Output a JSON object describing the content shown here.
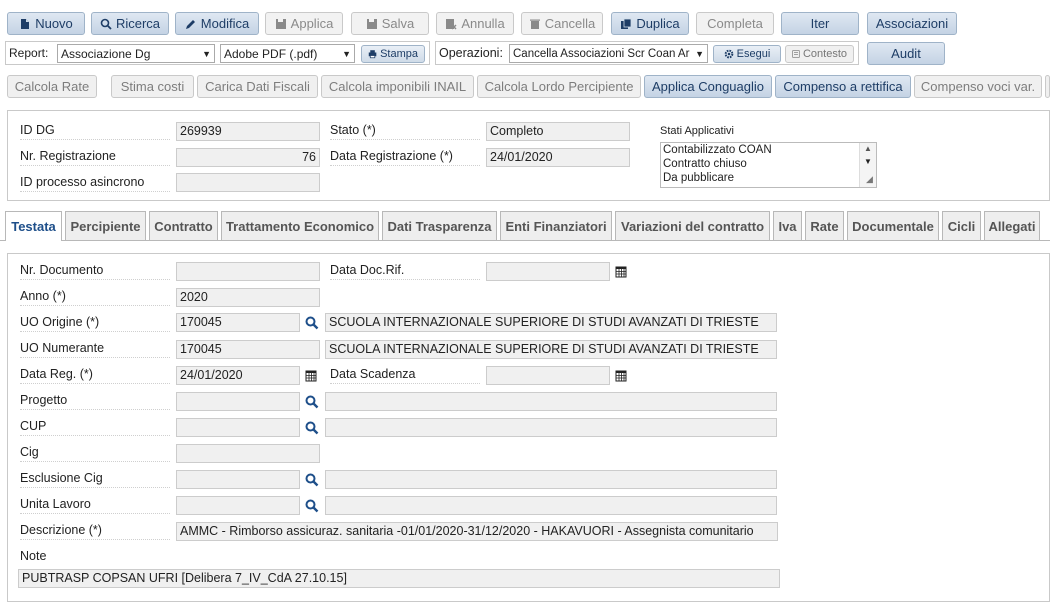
{
  "toolbar_row1": {
    "nuovo": "Nuovo",
    "ricerca": "Ricerca",
    "modifica": "Modifica",
    "applica": "Applica",
    "salva": "Salva",
    "annulla": "Annulla",
    "cancella": "Cancella",
    "duplica": "Duplica",
    "completa": "Completa",
    "iter": "Iter",
    "associazioni": "Associazioni"
  },
  "toolbar_row2": {
    "report_label": "Report:",
    "report_value": "Associazione Dg",
    "format_value": "Adobe PDF (.pdf)",
    "stampa": "Stampa",
    "operazioni_label": "Operazioni:",
    "operazioni_value": "Cancella Associazioni Scr Coan Ar",
    "esegui": "Esegui",
    "contesto": "Contesto",
    "audit": "Audit"
  },
  "toolbar_row3": {
    "calcola_rate": "Calcola Rate",
    "stima_costi": "Stima costi",
    "carica_dati_fiscali": "Carica Dati Fiscali",
    "calcola_imponibili": "Calcola imponibili INAIL",
    "calcola_lordo": "Calcola Lordo Percipiente",
    "applica_conguaglio": "Applica Conguaglio",
    "compenso_rettifica": "Compenso a rettifica",
    "compenso_voci": "Compenso voci var."
  },
  "header": {
    "id_dg_label": "ID DG",
    "id_dg_value": "269939",
    "nr_reg_label": "Nr. Registrazione",
    "nr_reg_value": "76",
    "id_processo_label": "ID processo asincrono",
    "id_processo_value": "",
    "stato_label": "Stato (*)",
    "stato_value": "Completo",
    "data_reg_label": "Data Registrazione (*)",
    "data_reg_value": "24/01/2020",
    "stati_label": "Stati Applicativi",
    "stati_items": [
      "Contabilizzato COAN",
      "Contratto chiuso",
      "Da pubblicare"
    ]
  },
  "tabs": [
    "Testata",
    "Percipiente",
    "Contratto",
    "Trattamento Economico",
    "Dati Trasparenza",
    "Enti Finanziatori",
    "Variazioni del contratto",
    "Iva",
    "Rate",
    "Documentale",
    "Cicli",
    "Allegati"
  ],
  "form": {
    "nr_documento_label": "Nr. Documento",
    "nr_documento_value": "",
    "data_doc_rif_label": "Data Doc.Rif.",
    "data_doc_rif_value": "",
    "anno_label": "Anno (*)",
    "anno_value": "2020",
    "uo_origine_label": "UO Origine (*)",
    "uo_origine_code": "170045",
    "uo_origine_desc": "SCUOLA INTERNAZIONALE SUPERIORE DI STUDI AVANZATI DI TRIESTE",
    "uo_numerante_label": "UO Numerante",
    "uo_numerante_code": "170045",
    "uo_numerante_desc": "SCUOLA INTERNAZIONALE SUPERIORE DI STUDI AVANZATI DI TRIESTE",
    "data_reg_label": "Data Reg. (*)",
    "data_reg_value": "24/01/2020",
    "data_scadenza_label": "Data Scadenza",
    "data_scadenza_value": "",
    "progetto_label": "Progetto",
    "cup_label": "CUP",
    "cig_label": "Cig",
    "esclusione_cig_label": "Esclusione Cig",
    "unita_lavoro_label": "Unita Lavoro",
    "descrizione_label": "Descrizione (*)",
    "descrizione_value": "AMMC - Rimborso assicuraz. sanitaria -01/01/2020-31/12/2020 - HAKAVUORI - Assegnista comunitario",
    "note_label": "Note",
    "note_value": "PUBTRASP COPSAN UFRI [Delibera 7_IV_CdA 27.10.15]"
  }
}
